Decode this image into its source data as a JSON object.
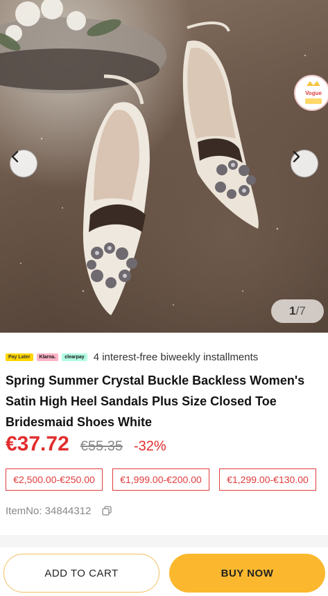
{
  "gallery": {
    "current": "1",
    "total": "/7",
    "badge_text": "Vogue"
  },
  "installments": {
    "badges": [
      "Pay Later",
      "Klarna.",
      "clearpay"
    ],
    "text": "4 interest-free biweekly installments"
  },
  "product": {
    "title": "Spring Summer Crystal Buckle Backless Women's Satin High Heel Sandals Plus Size Closed Toe Bridesmaid Shoes White",
    "price": "€37.72",
    "old_price": "€55.35",
    "discount": "-32%",
    "item_no": "ItemNo: 34844312"
  },
  "coupons": [
    "€2,500.00-€250.00",
    "€1,999.00-€200.00",
    "€1,299.00-€130.00"
  ],
  "actions": {
    "add_to_cart": "ADD TO CART",
    "buy_now": "BUY NOW"
  },
  "colors": {
    "price_red": "#e22d2d",
    "buy_button": "#fbb82e"
  }
}
